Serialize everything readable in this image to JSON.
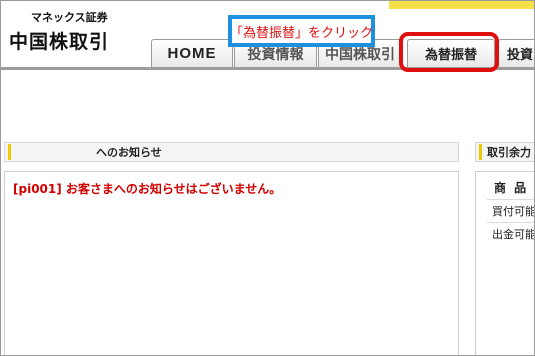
{
  "header": {
    "logo_top": "マネックス証券",
    "logo_main": "中国株取引"
  },
  "tabs": {
    "home": "HOME",
    "info": "投資情報",
    "trade": "中国株取引",
    "fx": "為替振替",
    "invest": "投資"
  },
  "annotation": "「為替振替」をクリック",
  "left_panel": {
    "title": "へのお知らせ",
    "notice": "[pi001] お客さまへのお知らせはございません。"
  },
  "right_panel": {
    "title": "取引余力",
    "product_header": "商 品",
    "rows": [
      "買付可能額",
      "出金可能額"
    ]
  },
  "colors": {
    "annotation_border": "#1e90e0",
    "highlight_border": "#e01010",
    "notice_text": "#d40000",
    "title_marker": "#f0c800"
  }
}
